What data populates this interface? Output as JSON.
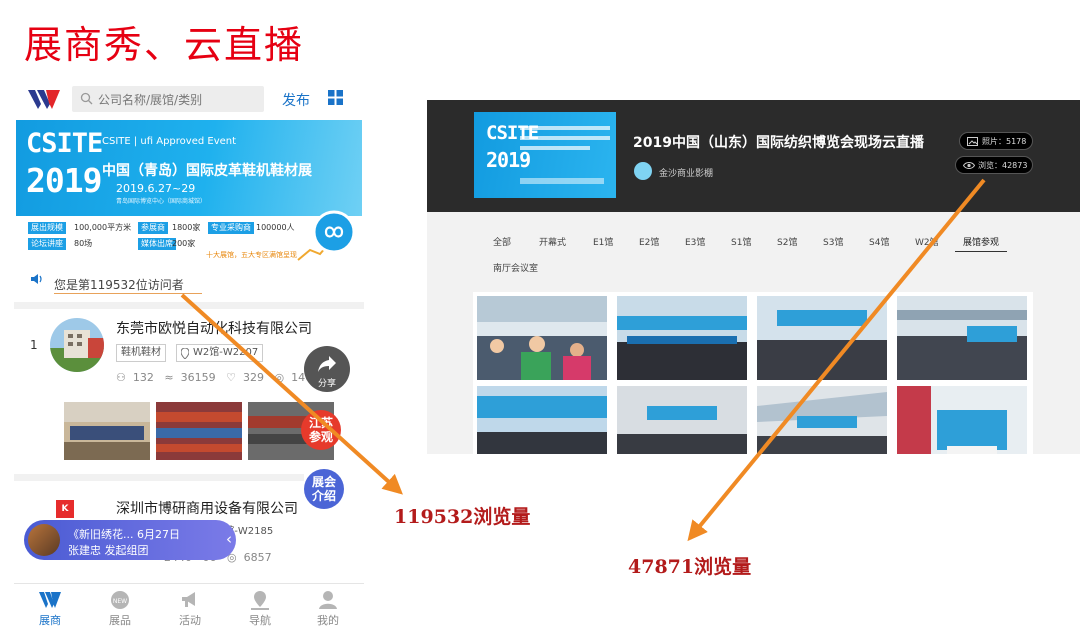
{
  "slide_title": "展商秀、云直播",
  "phone": {
    "search_placeholder": "公司名称/展馆/类别",
    "publish_label": "发布",
    "banner": {
      "line1": "CSITE",
      "line2": "2019",
      "logos": "CSITE | ufi Approved Event",
      "main_title": "中国（青岛）国际皮革鞋机鞋材展",
      "date": "2019.6.27~29",
      "venue": "青岛国际博览中心（国际商城馆）"
    },
    "stats": [
      {
        "label": "展出规模",
        "value": "100,000平方米"
      },
      {
        "label": "参展商",
        "value": "1800家"
      },
      {
        "label": "专业采购商",
        "value": "100000人"
      },
      {
        "label": "论坛讲座",
        "value": "80场"
      },
      {
        "label": "媒体出席",
        "value": "200家"
      }
    ],
    "stats_note": "十大展馆，五大专区满馆呈现",
    "visitor_text": "您是第119532位访问者",
    "companies": [
      {
        "rank": "1",
        "name": "东莞市欧悦自动化科技有限公司",
        "category": "鞋机鞋材",
        "booth": "W2馆-W2207",
        "counts": [
          "132",
          "36159",
          "329",
          "1467"
        ]
      },
      {
        "rank": "2",
        "name": "深圳市博研商用设备有限公司",
        "logo_text": "K",
        "booth": "W2馆-W2185",
        "counts": [
          "2440",
          "06",
          "6857"
        ]
      }
    ],
    "share_label": "分享",
    "float_red": [
      "江苏",
      "参观"
    ],
    "float_blue": [
      "展会",
      "介绍"
    ],
    "group_bubble": {
      "line1": "《新旧绣花...    6月27日",
      "line2": "张建忠 发起组团"
    },
    "nav": [
      "展商",
      "展品",
      "活动",
      "导航",
      "我的"
    ]
  },
  "web": {
    "poster_line1": "CSITE",
    "poster_line2": "2019",
    "title": "2019中国（山东）国际纺织博览会现场云直播",
    "org_name": "金沙商业影棚",
    "photo_count": "照片：5178",
    "view_count": "浏览：42873",
    "tabs": [
      "全部",
      "开幕式",
      "E1馆",
      "E2馆",
      "E3馆",
      "S1馆",
      "S2馆",
      "S3馆",
      "S4馆",
      "W2馆",
      "展馆参观",
      "南厅会议室"
    ],
    "active_tab": "展馆参观"
  },
  "annotations": {
    "left": "119532浏览量",
    "right": "47871浏览量"
  },
  "colors": {
    "title_red": "#e60012",
    "annotation_red": "#b31b1b",
    "arrow_orange": "#f08a24",
    "brand_blue": "#1a73c8",
    "banner_blue": "#129be0"
  }
}
